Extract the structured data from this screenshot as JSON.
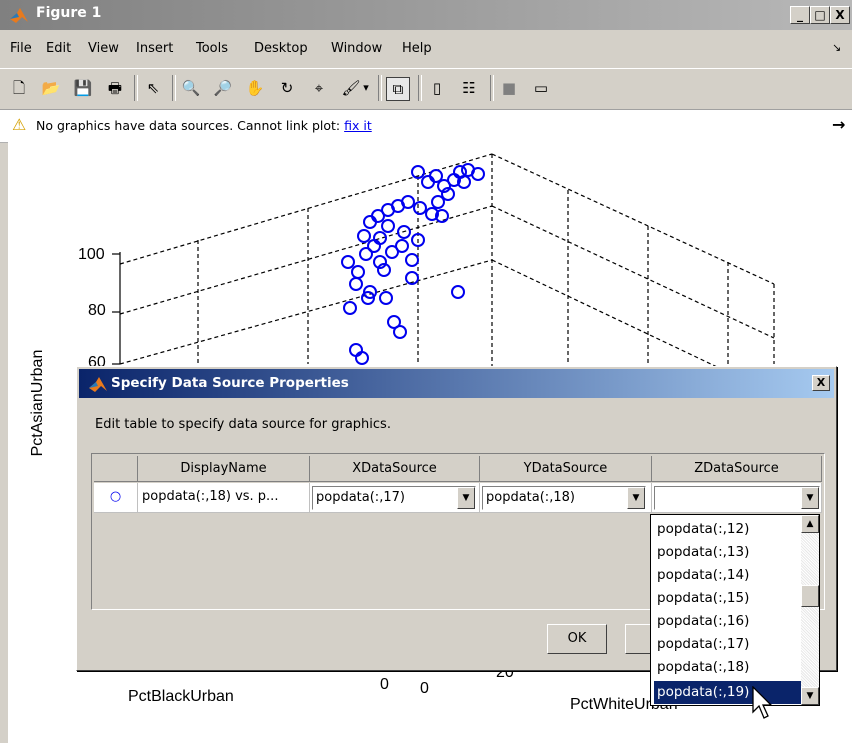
{
  "window": {
    "title": "Figure 1",
    "min": "_",
    "max": "□",
    "close": "X"
  },
  "menu": [
    "File",
    "Edit",
    "View",
    "Insert",
    "Tools",
    "Desktop",
    "Window",
    "Help"
  ],
  "menu_arrow": "↘",
  "toolbar": {
    "icons": [
      "new-file-icon",
      "open-folder-icon",
      "save-icon",
      "print-icon",
      "pointer-icon",
      "zoom-in-icon",
      "zoom-out-icon",
      "pan-hand-icon",
      "rotate-3d-icon",
      "data-cursor-icon",
      "brush-icon",
      "brush-dropdown-icon",
      "link-plot-icon",
      "colorbar-icon",
      "legend-icon",
      "hide-plot-tools-icon",
      "show-plot-tools-icon"
    ],
    "glyphs": [
      "🗋",
      "📂",
      "💾",
      "🖶",
      "⇖",
      "🔍",
      "🔎",
      "✋",
      "↻",
      "⌖",
      "🖌",
      "▾",
      "⧉",
      "▯",
      "☷",
      "■",
      "▭"
    ]
  },
  "warning": {
    "icon": "⚠",
    "text": "No graphics have data sources. Cannot link plot: ",
    "link": "fix it",
    "arrow": "→"
  },
  "chart_data": {
    "type": "scatter",
    "zlabel": "PctAsianUrban",
    "xlabel": "PctBlackUrban",
    "ylabel": "PctWhiteUrban",
    "ticks_visible": [
      "100",
      "80",
      "60",
      "0",
      "0",
      "20"
    ],
    "marker": "o",
    "marker_color": "#0000ff",
    "grid": true,
    "points_note_hidden": "",
    "points": [
      {
        "x": 0,
        "y": 95,
        "z": 95
      }
    ]
  },
  "dialog": {
    "title": "Specify Data Source Properties",
    "close": "X",
    "instruction": "Edit table to specify data source for graphics.",
    "columns": [
      "",
      "DisplayName",
      "XDataSource",
      "YDataSource",
      "ZDataSource"
    ],
    "row": {
      "marker": "○",
      "display_name": "popdata(:,18) vs. p...",
      "x_source": "popdata(:,17)",
      "y_source": "popdata(:,18)",
      "z_source": ""
    },
    "ok": "OK",
    "cancel": ""
  },
  "dropdown": {
    "options": [
      "popdata(:,12)",
      "popdata(:,13)",
      "popdata(:,14)",
      "popdata(:,15)",
      "popdata(:,16)",
      "popdata(:,17)",
      "popdata(:,18)",
      "popdata(:,19)"
    ],
    "selected_index": 7
  }
}
